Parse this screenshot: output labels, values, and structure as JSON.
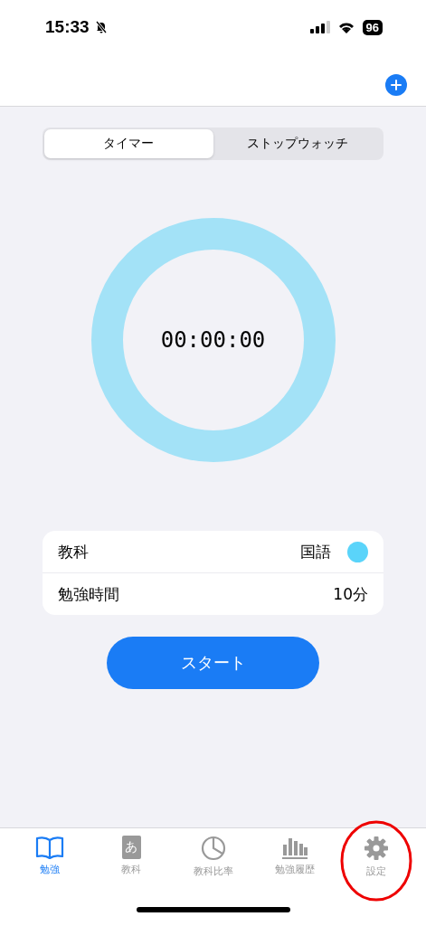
{
  "status_bar": {
    "time": "15:33",
    "battery": "96"
  },
  "segments": [
    {
      "label": "タイマー",
      "selected": true
    },
    {
      "label": "ストップウォッチ",
      "selected": false
    }
  ],
  "timer": {
    "display": "00:00:00"
  },
  "settings": [
    {
      "kind": "subject",
      "label": "教科",
      "value": "国語",
      "color": "#5ad4fa"
    },
    {
      "kind": "plain",
      "label": "勉強時間",
      "value": "10分"
    }
  ],
  "start_button": "スタート",
  "tab_bar": [
    {
      "kind": "book",
      "label": "勉強",
      "selected": true
    },
    {
      "kind": "dictionary",
      "label": "教科",
      "glyph": "あ",
      "selected": false
    },
    {
      "kind": "pie",
      "label": "教科比率",
      "selected": false
    },
    {
      "kind": "bars",
      "label": "勉強履歴",
      "selected": false
    },
    {
      "kind": "gear",
      "label": "設定",
      "selected": false,
      "highlighted": true
    }
  ]
}
